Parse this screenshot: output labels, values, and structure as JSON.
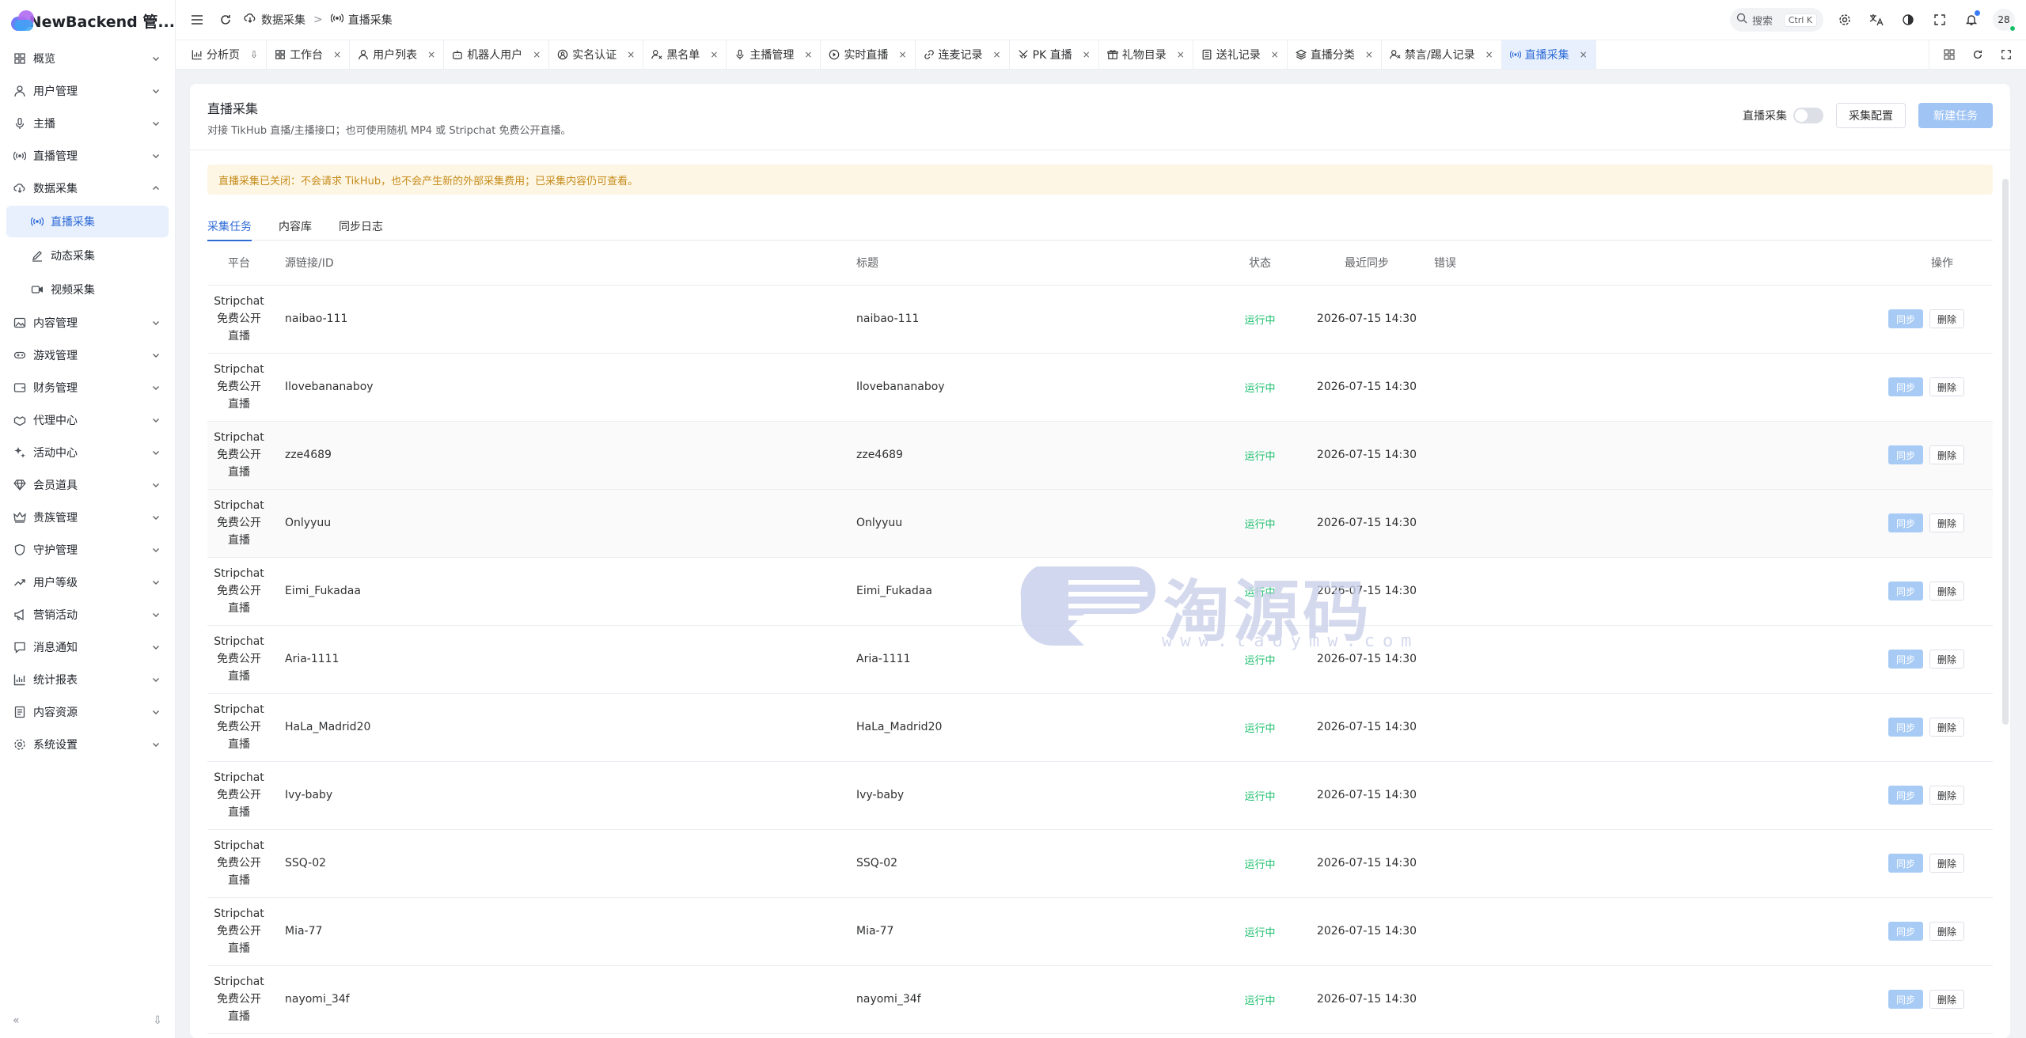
{
  "app": {
    "name": "NewBackend 管..."
  },
  "sidebar": {
    "items": [
      {
        "label": "概览",
        "icon": "grid-icon"
      },
      {
        "label": "用户管理",
        "icon": "user-icon"
      },
      {
        "label": "主播",
        "icon": "mic-icon"
      },
      {
        "label": "直播管理",
        "icon": "broadcast-icon"
      },
      {
        "label": "数据采集",
        "icon": "cloud-download-icon"
      },
      {
        "label": "直播采集",
        "icon": "broadcast-icon"
      },
      {
        "label": "动态采集",
        "icon": "edit-icon"
      },
      {
        "label": "视频采集",
        "icon": "video-icon"
      },
      {
        "label": "内容管理",
        "icon": "image-icon"
      },
      {
        "label": "游戏管理",
        "icon": "gamepad-icon"
      },
      {
        "label": "财务管理",
        "icon": "wallet-icon"
      },
      {
        "label": "代理中心",
        "icon": "handshake-icon"
      },
      {
        "label": "活动中心",
        "icon": "sparkle-icon"
      },
      {
        "label": "会员道具",
        "icon": "diamond-icon"
      },
      {
        "label": "贵族管理",
        "icon": "crown-icon"
      },
      {
        "label": "守护管理",
        "icon": "shield-icon"
      },
      {
        "label": "用户等级",
        "icon": "trend-icon"
      },
      {
        "label": "营销活动",
        "icon": "megaphone-icon"
      },
      {
        "label": "消息通知",
        "icon": "message-icon"
      },
      {
        "label": "统计报表",
        "icon": "bar-chart-icon"
      },
      {
        "label": "内容资源",
        "icon": "book-icon"
      },
      {
        "label": "系统设置",
        "icon": "gear-icon"
      }
    ],
    "collapse_glyph": "«",
    "pin_glyph": "⇩"
  },
  "header": {
    "crumbs": [
      "数据采集",
      "直播采集"
    ],
    "crumb_sep": ">",
    "search_placeholder": "搜索",
    "search_kbd": "Ctrl K",
    "avatar_text": "28"
  },
  "tabs": [
    {
      "label": "分析页",
      "icon": "bar-chart-icon",
      "pinned": true
    },
    {
      "label": "工作台",
      "icon": "grid-icon"
    },
    {
      "label": "用户列表",
      "icon": "user-icon"
    },
    {
      "label": "机器人用户",
      "icon": "robot-icon"
    },
    {
      "label": "实名认证",
      "icon": "id-icon"
    },
    {
      "label": "黑名单",
      "icon": "block-user-icon"
    },
    {
      "label": "主播管理",
      "icon": "mic-icon"
    },
    {
      "label": "实时直播",
      "icon": "play-icon"
    },
    {
      "label": "连麦记录",
      "icon": "link-icon"
    },
    {
      "label": "PK 直播",
      "icon": "swords-icon"
    },
    {
      "label": "礼物目录",
      "icon": "gift-icon"
    },
    {
      "label": "送礼记录",
      "icon": "record-icon"
    },
    {
      "label": "直播分类",
      "icon": "layers-icon"
    },
    {
      "label": "禁言/踢人记录",
      "icon": "mute-user-icon"
    },
    {
      "label": "直播采集",
      "icon": "broadcast-icon",
      "active": true
    }
  ],
  "page": {
    "title": "直播采集",
    "desc": "对接 TikHub 直播/主播接口；也可使用随机 MP4 或 Stripchat 免费公开直播。",
    "switch_label": "直播采集",
    "config_label": "采集配置",
    "new_task_label": "新建任务",
    "alert": "直播采集已关闭：不会请求 TikHub，也不会产生新的外部采集费用；已采集内容仍可查看。",
    "inner_tabs": [
      "采集任务",
      "内容库",
      "同步日志"
    ]
  },
  "table": {
    "columns": [
      "平台",
      "源链接/ID",
      "标题",
      "状态",
      "最近同步",
      "错误",
      "操作"
    ],
    "sync_label": "同步",
    "delete_label": "删除",
    "rows": [
      {
        "platform": "Stripchat\n免费公开\n直播",
        "source": "naibao-111",
        "title": "naibao-111",
        "status": "运行中",
        "synced": "2026-07-15 14:30",
        "error": ""
      },
      {
        "platform": "Stripchat\n免费公开\n直播",
        "source": "Ilovebananaboy",
        "title": "Ilovebananaboy",
        "status": "运行中",
        "synced": "2026-07-15 14:30",
        "error": ""
      },
      {
        "platform": "Stripchat\n免费公开\n直播",
        "source": "zze4689",
        "title": "zze4689",
        "status": "运行中",
        "synced": "2026-07-15 14:30",
        "error": ""
      },
      {
        "platform": "Stripchat\n免费公开\n直播",
        "source": "Onlyyuu",
        "title": "Onlyyuu",
        "status": "运行中",
        "synced": "2026-07-15 14:30",
        "error": ""
      },
      {
        "platform": "Stripchat\n免费公开\n直播",
        "source": "Eimi_Fukadaa",
        "title": "Eimi_Fukadaa",
        "status": "运行中",
        "synced": "2026-07-15 14:30",
        "error": ""
      },
      {
        "platform": "Stripchat\n免费公开\n直播",
        "source": "Aria-1111",
        "title": "Aria-1111",
        "status": "运行中",
        "synced": "2026-07-15 14:30",
        "error": ""
      },
      {
        "platform": "Stripchat\n免费公开\n直播",
        "source": "HaLa_Madrid20",
        "title": "HaLa_Madrid20",
        "status": "运行中",
        "synced": "2026-07-15 14:30",
        "error": ""
      },
      {
        "platform": "Stripchat\n免费公开\n直播",
        "source": "Ivy-baby",
        "title": "Ivy-baby",
        "status": "运行中",
        "synced": "2026-07-15 14:30",
        "error": ""
      },
      {
        "platform": "Stripchat\n免费公开\n直播",
        "source": "SSQ-02",
        "title": "SSQ-02",
        "status": "运行中",
        "synced": "2026-07-15 14:30",
        "error": ""
      },
      {
        "platform": "Stripchat\n免费公开\n直播",
        "source": "Mia-77",
        "title": "Mia-77",
        "status": "运行中",
        "synced": "2026-07-15 14:30",
        "error": ""
      },
      {
        "platform": "Stripchat\n免费公开\n直播",
        "source": "nayomi_34f",
        "title": "nayomi_34f",
        "status": "运行中",
        "synced": "2026-07-15 14:30",
        "error": ""
      }
    ]
  },
  "watermark": {
    "text": "淘源码",
    "sub": "www.taoymw.com"
  },
  "colors": {
    "accent": "#2d6ad6",
    "status_running": "#19be6b",
    "alert_text": "#c58b1a",
    "alert_bg": "#fdf6e4"
  }
}
